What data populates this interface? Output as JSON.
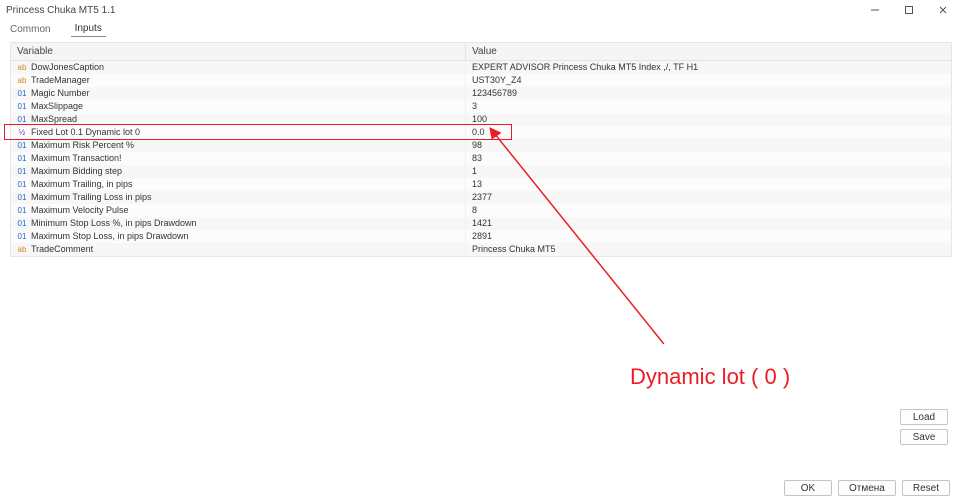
{
  "window": {
    "title": "Princess Chuka MT5 1.1"
  },
  "tabs": {
    "common": "Common",
    "inputs": "Inputs",
    "active": "inputs"
  },
  "headers": {
    "variable": "Variable",
    "value": "Value"
  },
  "rows": [
    {
      "icon": "text",
      "name": "DowJonesCaption",
      "value": "EXPERT ADVISOR Princess Chuka MT5 Index ,/, TF H1"
    },
    {
      "icon": "text",
      "name": "TradeManager",
      "value": "UST30Y_Z4"
    },
    {
      "icon": "num",
      "name": "Magic Number",
      "value": "123456789"
    },
    {
      "icon": "num",
      "name": "MaxSlippage",
      "value": "3"
    },
    {
      "icon": "num",
      "name": "MaxSpread",
      "value": "100"
    },
    {
      "icon": "float",
      "name": "Fixed Lot 0.1 Dynamic lot 0",
      "value": "0.0"
    },
    {
      "icon": "num",
      "name": "Maximum Risk Percent %",
      "value": "98"
    },
    {
      "icon": "num",
      "name": "Maximum Transaction!",
      "value": "83"
    },
    {
      "icon": "num",
      "name": "Maximum Bidding step",
      "value": "1"
    },
    {
      "icon": "num",
      "name": "Maximum Trailing, in pips",
      "value": "13"
    },
    {
      "icon": "num",
      "name": "Maximum Trailing Loss in pips",
      "value": "2377"
    },
    {
      "icon": "num",
      "name": "Maximum Velocity Pulse",
      "value": "8"
    },
    {
      "icon": "num",
      "name": "Minimum Stop Loss %, in pips Drawdown",
      "value": "1421"
    },
    {
      "icon": "num",
      "name": "Maximum Stop Loss, in pips Drawdown",
      "value": "2891"
    },
    {
      "icon": "text",
      "name": "TradeComment",
      "value": "Princess Chuka MT5"
    }
  ],
  "annotation": {
    "label": "Dynamic lot ( 0 )"
  },
  "buttons": {
    "load": "Load",
    "save": "Save",
    "ok": "OK",
    "cancel": "Отмена",
    "reset": "Reset"
  }
}
